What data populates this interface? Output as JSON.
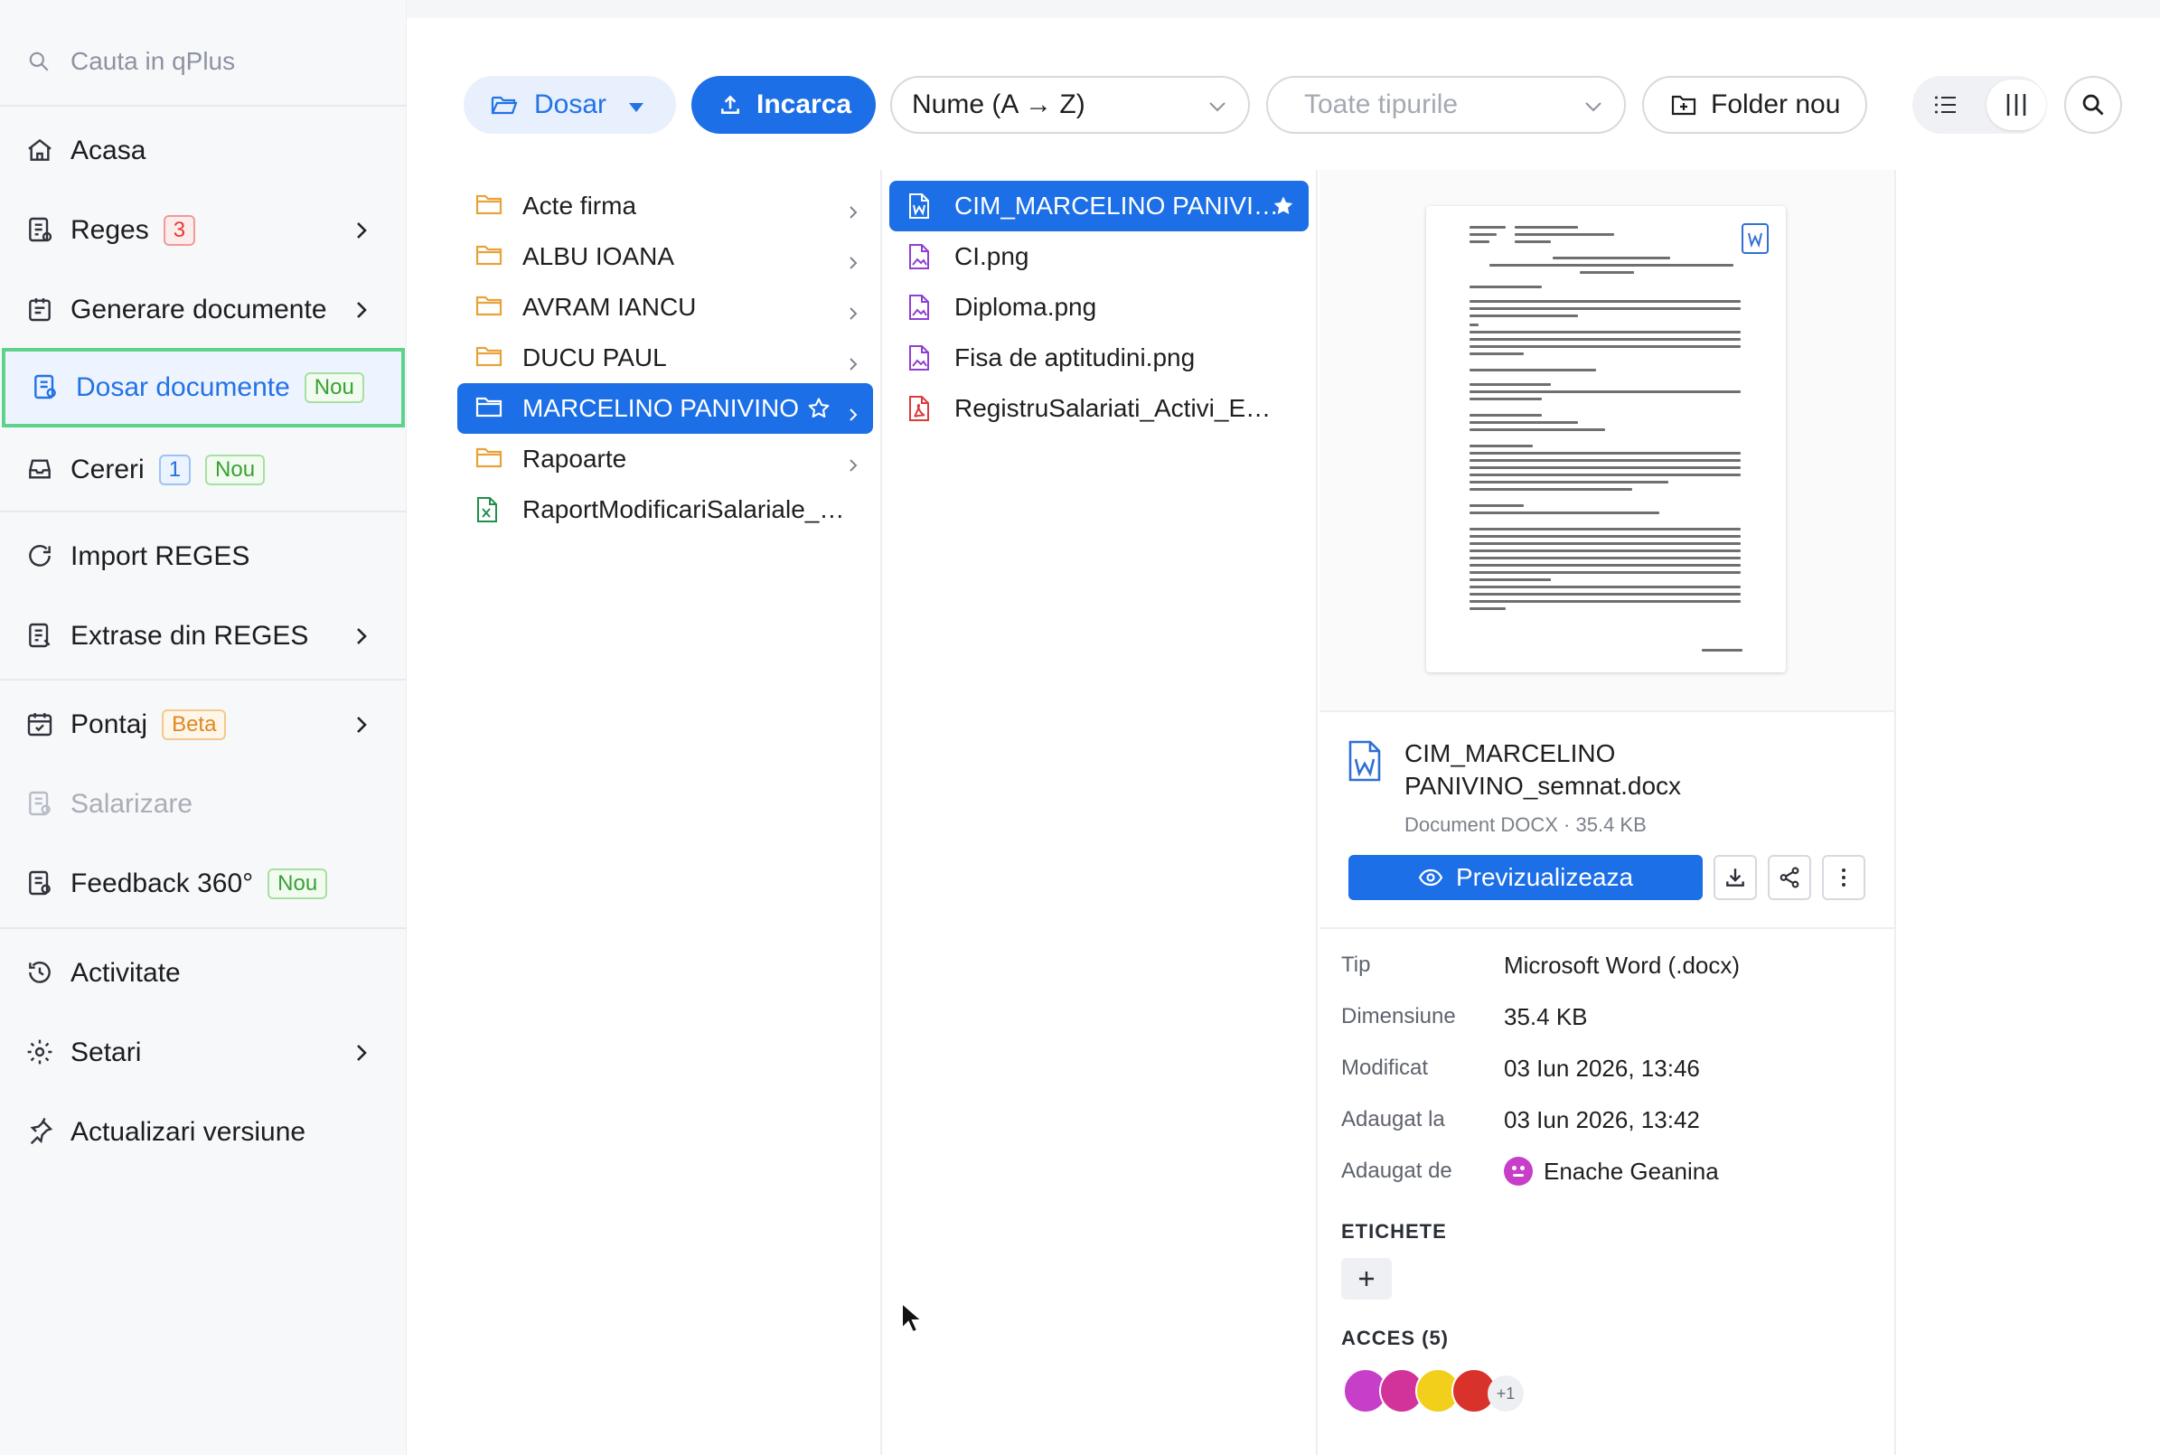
{
  "sidebar": {
    "search_placeholder": "Cauta in qPlus",
    "items": [
      {
        "label": "Acasa"
      },
      {
        "label": "Reges",
        "badge": "3"
      },
      {
        "label": "Generare documente"
      },
      {
        "label": "Dosar documente",
        "badge": "Nou"
      },
      {
        "label": "Cereri",
        "badge": "1",
        "badge2": "Nou"
      },
      {
        "label": "Import REGES"
      },
      {
        "label": "Extrase din REGES"
      },
      {
        "label": "Pontaj",
        "badge": "Beta"
      },
      {
        "label": "Salarizare"
      },
      {
        "label": "Feedback 360°",
        "badge": "Nou"
      },
      {
        "label": "Activitate"
      },
      {
        "label": "Setari"
      },
      {
        "label": "Actualizari versiune"
      }
    ]
  },
  "toolbar": {
    "dosar_label": "Dosar",
    "upload_label": "Incarca",
    "sort_value": "Nume (A → Z)",
    "types_placeholder": "Toate tipurile",
    "new_folder_label": "Folder nou"
  },
  "folders": [
    {
      "name": "Acte firma"
    },
    {
      "name": "ALBU IOANA"
    },
    {
      "name": "AVRAM IANCU"
    },
    {
      "name": "DUCU PAUL"
    },
    {
      "name": "MARCELINO PANIVINO"
    },
    {
      "name": "Rapoarte"
    },
    {
      "name": "RaportModificariSalariale_202…"
    }
  ],
  "files": [
    {
      "name": "CIM_MARCELINO PANIVIN…"
    },
    {
      "name": "CI.png"
    },
    {
      "name": "Diploma.png"
    },
    {
      "name": "Fisa de aptitudini.png"
    },
    {
      "name": "RegistruSalariati_Activi_ECOVI…"
    }
  ],
  "details": {
    "title": "CIM_MARCELINO PANIVINO_semnat.docx",
    "subtitle": "Document DOCX · 35.4 KB",
    "preview_label": "Previzualizeaza",
    "props": [
      {
        "k": "Tip",
        "v": "Microsoft Word (.docx)"
      },
      {
        "k": "Dimensiune",
        "v": "35.4 KB"
      },
      {
        "k": "Modificat",
        "v": "03 Iun 2026, 13:46"
      },
      {
        "k": "Adaugat la",
        "v": "03 Iun 2026, 13:42"
      },
      {
        "k": "Adaugat de",
        "v": "Enache Geanina"
      }
    ],
    "tags_title": "ETICHETE",
    "access_title": "ACCES (5)",
    "access_more": "+1"
  },
  "colors": {
    "accent": "#1c6fe6",
    "active_border": "#5fd28a",
    "folder": "#e7a33a",
    "word": "#2f6fd6",
    "image": "#8e3fd1",
    "pdf": "#d93b3b",
    "excel": "#1f8f4a"
  }
}
